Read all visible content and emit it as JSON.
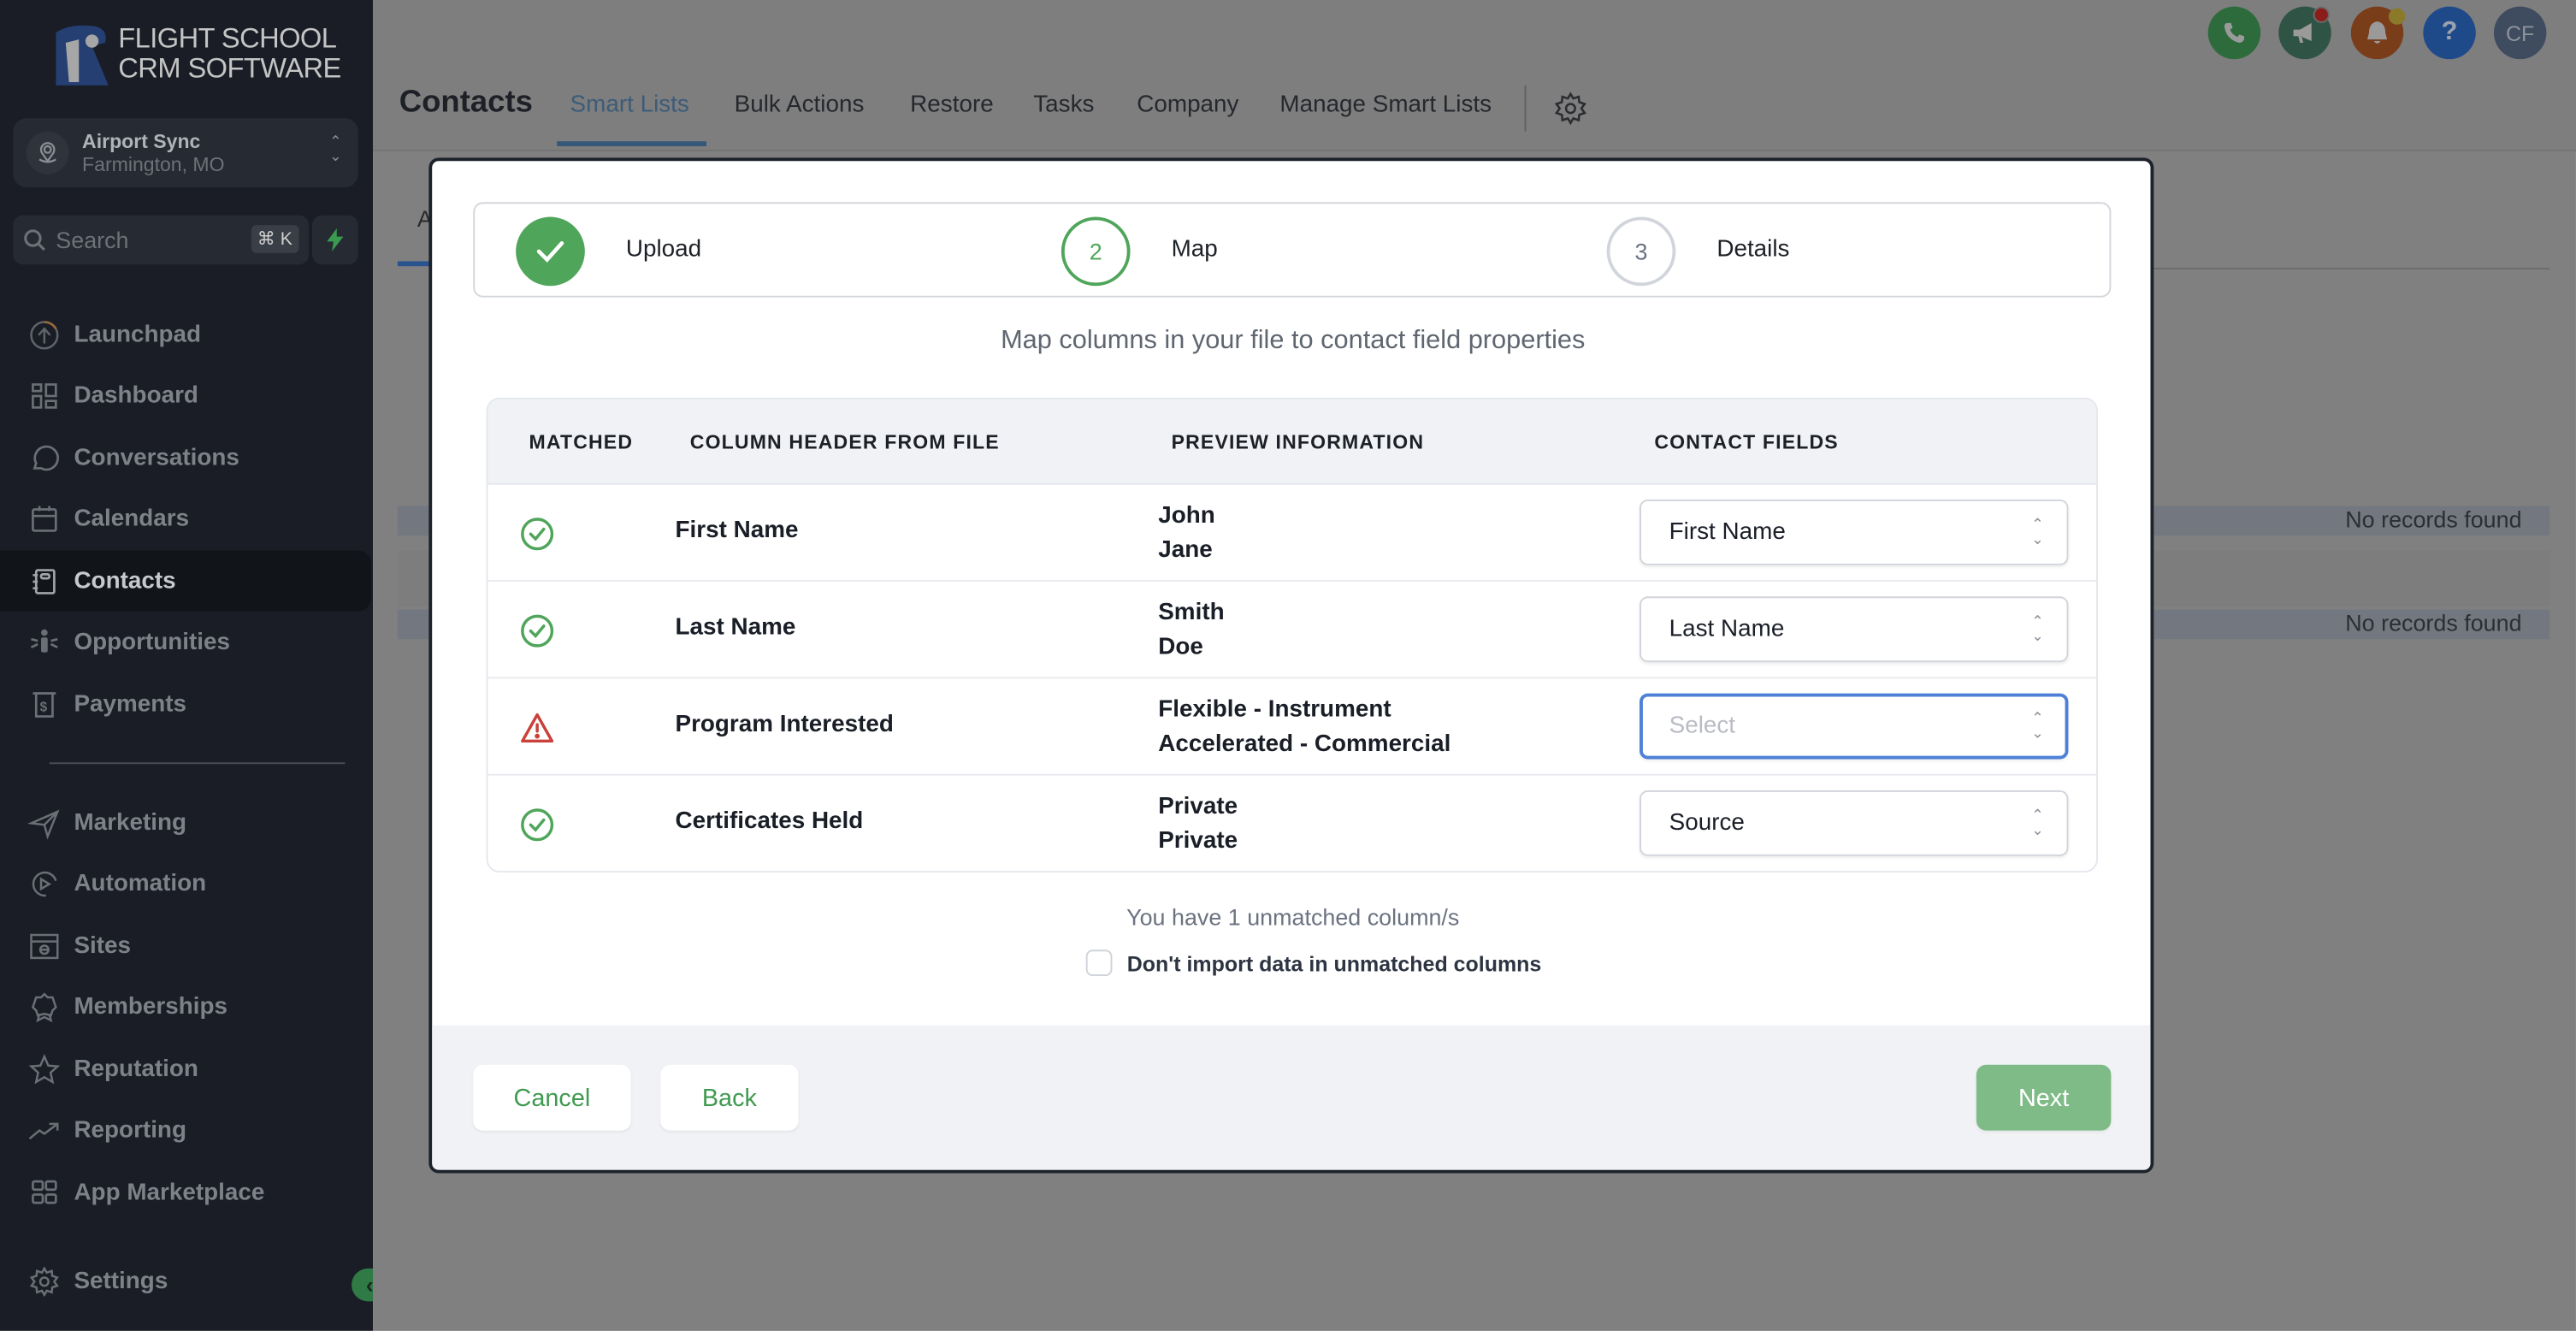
{
  "brand": {
    "line1": "FLIGHT SCHOOL",
    "line2": "CRM SOFTWARE"
  },
  "location": {
    "name": "Airport Sync",
    "city": "Farmington, MO"
  },
  "search": {
    "placeholder": "Search",
    "shortcut": "⌘ K"
  },
  "sidebar": {
    "items": [
      {
        "label": "Launchpad",
        "icon": "launchpad-icon"
      },
      {
        "label": "Dashboard",
        "icon": "dashboard-icon"
      },
      {
        "label": "Conversations",
        "icon": "chat-icon"
      },
      {
        "label": "Calendars",
        "icon": "calendar-icon"
      },
      {
        "label": "Contacts",
        "icon": "contacts-icon",
        "active": true
      },
      {
        "label": "Opportunities",
        "icon": "opportunities-icon"
      },
      {
        "label": "Payments",
        "icon": "payments-icon"
      }
    ],
    "items2": [
      {
        "label": "Marketing",
        "icon": "send-icon"
      },
      {
        "label": "Automation",
        "icon": "automation-icon"
      },
      {
        "label": "Sites",
        "icon": "sites-icon"
      },
      {
        "label": "Memberships",
        "icon": "badge-icon"
      },
      {
        "label": "Reputation",
        "icon": "star-icon"
      },
      {
        "label": "Reporting",
        "icon": "trend-icon"
      },
      {
        "label": "App Marketplace",
        "icon": "apps-icon"
      }
    ],
    "settings": "Settings"
  },
  "header": {
    "title": "Contacts",
    "tabs": [
      "Smart Lists",
      "Bulk Actions",
      "Restore",
      "Tasks",
      "Company",
      "Manage Smart Lists"
    ],
    "active_tab": "Smart Lists",
    "avatar_initials": "CF"
  },
  "background": {
    "tab_partial": "A",
    "no_records": "No records found"
  },
  "modal": {
    "steps": [
      {
        "number": "1",
        "label": "Upload",
        "state": "done"
      },
      {
        "number": "2",
        "label": "Map",
        "state": "current"
      },
      {
        "number": "3",
        "label": "Details",
        "state": "pending"
      }
    ],
    "subtitle": "Map columns in your file to contact field properties",
    "columns": [
      "MATCHED",
      "COLUMN HEADER FROM FILE",
      "PREVIEW INFORMATION",
      "CONTACT FIELDS"
    ],
    "rows": [
      {
        "matched": true,
        "column": "First Name",
        "preview": [
          "John",
          "Jane"
        ],
        "field": "First Name"
      },
      {
        "matched": true,
        "column": "Last Name",
        "preview": [
          "Smith",
          "Doe"
        ],
        "field": "Last Name"
      },
      {
        "matched": false,
        "column": "Program Interested",
        "preview": [
          "Flexible - Instrument",
          "Accelerated - Commercial"
        ],
        "field": "",
        "placeholder": "Select"
      },
      {
        "matched": true,
        "column": "Certificates Held",
        "preview": [
          "Private",
          "Private"
        ],
        "field": "Source"
      }
    ],
    "unmatched_text": "You have 1 unmatched column/s",
    "skip_unmatched_label": "Don't import data in unmatched columns",
    "skip_unmatched_checked": false,
    "buttons": {
      "cancel": "Cancel",
      "back": "Back",
      "next": "Next"
    }
  },
  "colors": {
    "accent_green": "#4fa55a",
    "warning_red": "#c9413a",
    "focus_blue": "#4e80d8"
  }
}
